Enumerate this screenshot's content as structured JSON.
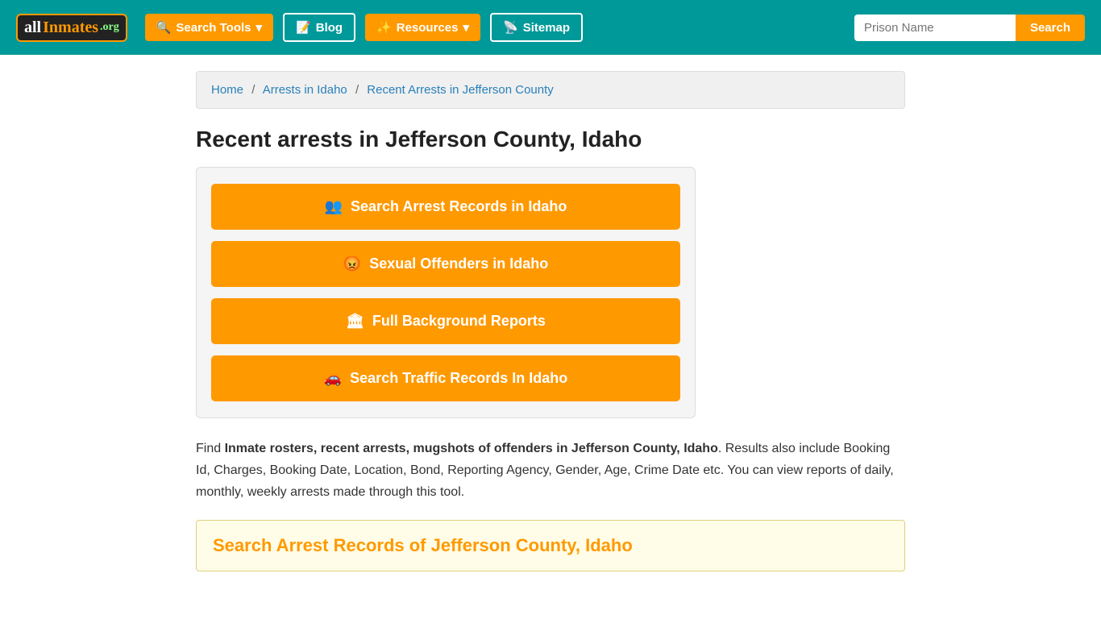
{
  "header": {
    "logo": {
      "text": "allInmates.org"
    },
    "nav": {
      "search_tools_label": "Search Tools",
      "blog_label": "Blog",
      "resources_label": "Resources",
      "sitemap_label": "Sitemap"
    },
    "search_placeholder": "Prison Name",
    "search_button_label": "Search"
  },
  "breadcrumb": {
    "home": "Home",
    "arrests_in_idaho": "Arrests in Idaho",
    "current": "Recent Arrests in Jefferson County"
  },
  "page_title": "Recent arrests in Jefferson County, Idaho",
  "action_buttons": [
    {
      "icon": "👥",
      "label": "Search Arrest Records in Idaho"
    },
    {
      "icon": "😡",
      "label": "Sexual Offenders in Idaho"
    },
    {
      "icon": "🏛",
      "label": "Full Background Reports"
    },
    {
      "icon": "🚗",
      "label": "Search Traffic Records In Idaho"
    }
  ],
  "description": {
    "prefix": "Find ",
    "bold_text": "Inmate rosters, recent arrests, mugshots of offenders in Jefferson County, Idaho",
    "suffix": ". Results also include Booking Id, Charges, Booking Date, Location, Bond, Reporting Agency, Gender, Age, Crime Date etc. You can view reports of daily, monthly, weekly arrests made through this tool."
  },
  "bottom_section": {
    "title": "Search Arrest Records of Jefferson County, Idaho"
  }
}
